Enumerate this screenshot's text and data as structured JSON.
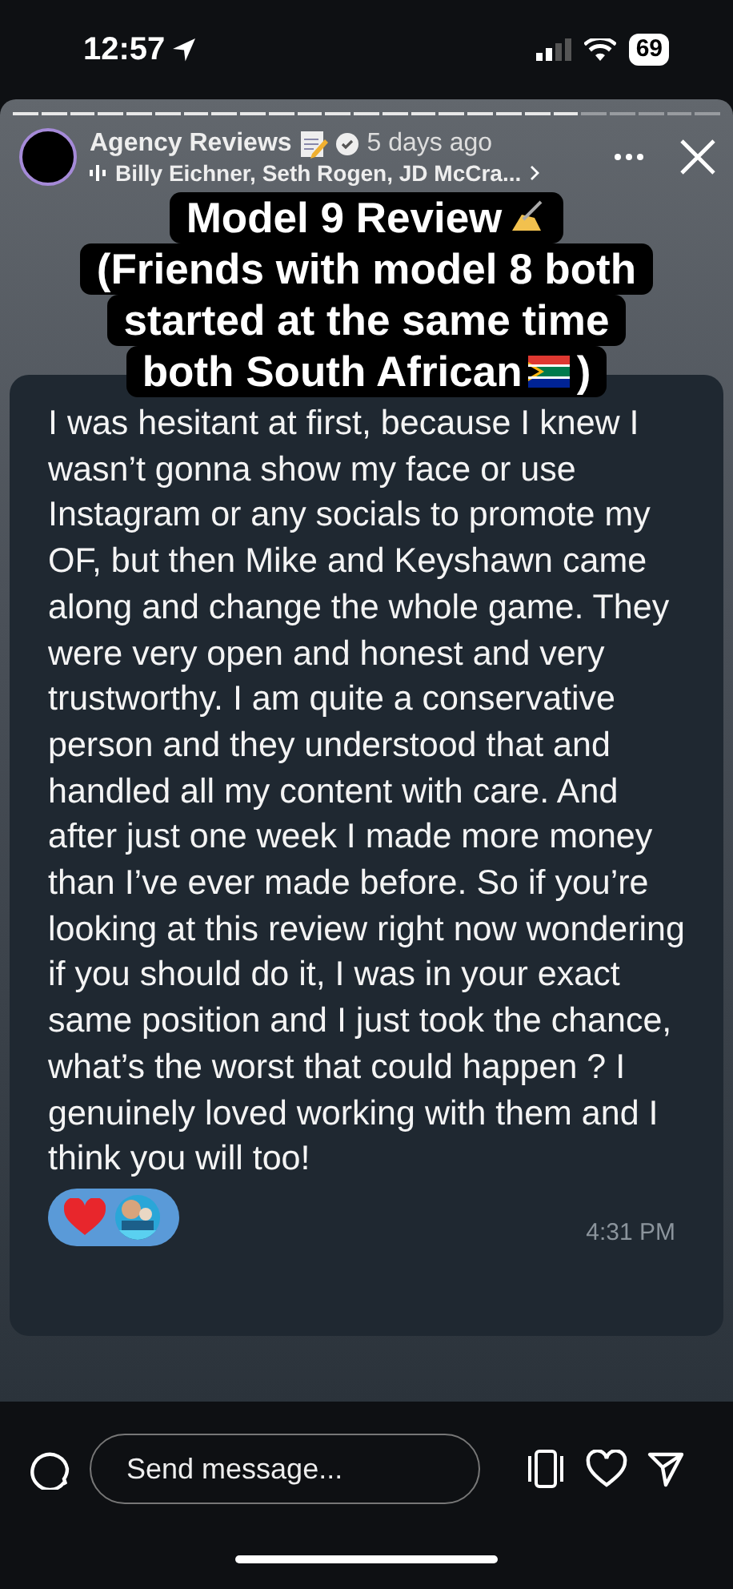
{
  "status_bar": {
    "time": "12:57",
    "battery": "69"
  },
  "story": {
    "progress": [
      {
        "level": 1
      },
      {
        "level": 1
      },
      {
        "level": 1
      },
      {
        "level": 1
      },
      {
        "level": 1
      },
      {
        "level": 1
      },
      {
        "level": 1
      },
      {
        "level": 1
      },
      {
        "level": 1
      },
      {
        "level": 1
      },
      {
        "level": 1
      },
      {
        "level": 1
      },
      {
        "level": 1
      },
      {
        "level": 1
      },
      {
        "level": 1
      },
      {
        "level": 1
      },
      {
        "level": 1
      },
      {
        "level": 1
      },
      {
        "level": 1
      },
      {
        "level": 1
      },
      {
        "level": 0
      },
      {
        "level": 0
      },
      {
        "level": 0
      },
      {
        "level": 0
      },
      {
        "level": 0
      }
    ],
    "account": "Agency Reviews",
    "verified": true,
    "posted": "5 days ago",
    "audio": "Billy Eichner, Seth Rogen, JD McCra...",
    "caption_lines": [
      "Model 9 Review",
      "(Friends with model 8 both",
      "started at the same time",
      "both South African"
    ],
    "caption_end": ")"
  },
  "message": {
    "text": "I was hesitant at first, because I knew I wasn’t gonna show my face or use Instagram or any socials to promote my OF, but then Mike and Keyshawn came along and change the whole game. They were very open and honest and very trustworthy. I am quite a conservative person and they understood that and handled all my content with care. And after just one week I made more money than I’ve ever made before. So if you’re looking at this review right now wondering if you should do it, I was in your exact same position and I just took the chance, what’s the worst that could happen ? I genuinely loved working with them and I think you will too!",
    "time": "4:31 PM"
  },
  "reply": {
    "placeholder": "Send message..."
  }
}
